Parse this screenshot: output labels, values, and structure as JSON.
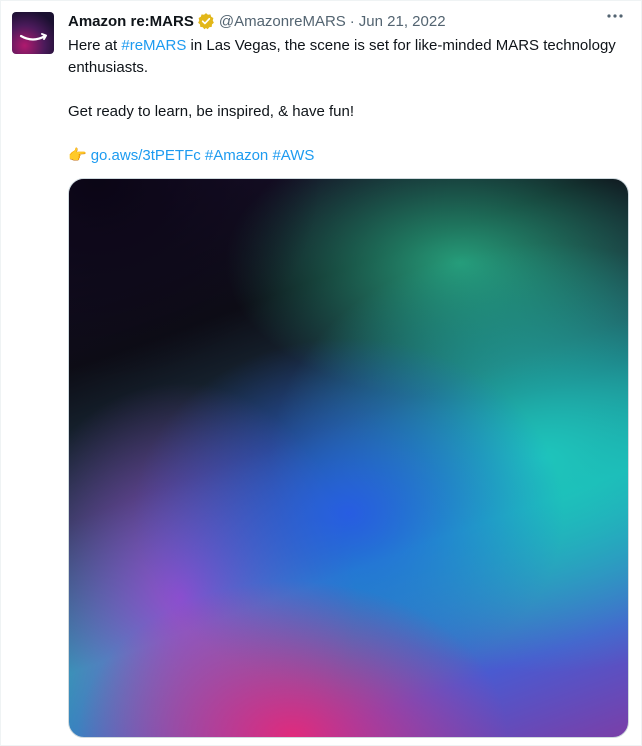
{
  "account": {
    "display_name": "Amazon re:MARS",
    "handle": "@AmazonreMARS",
    "separator": "·",
    "date": "Jun 21, 2022"
  },
  "icons": {
    "avatar": "amazon-smile-logo",
    "verified": "verified-badge-icon",
    "more": "more-horizontal-icon",
    "pointer": "backhand-index-pointing-right-emoji"
  },
  "tweet": {
    "line1_pre": "Here at ",
    "line1_hashtag": "#reMARS",
    "line1_post": " in Las Vegas, the scene is set for like-minded MARS technology enthusiasts.",
    "line2": "Get ready to learn, be inspired, & have fun!",
    "emoji": "👉",
    "link": "go.aws/3tPETFc",
    "hashtag_amazon": "#Amazon",
    "hashtag_aws": "#AWS"
  },
  "colors": {
    "link": "#1d9bf0",
    "muted": "#536471",
    "text": "#0f1419",
    "verified_gold": "#e2b719"
  }
}
